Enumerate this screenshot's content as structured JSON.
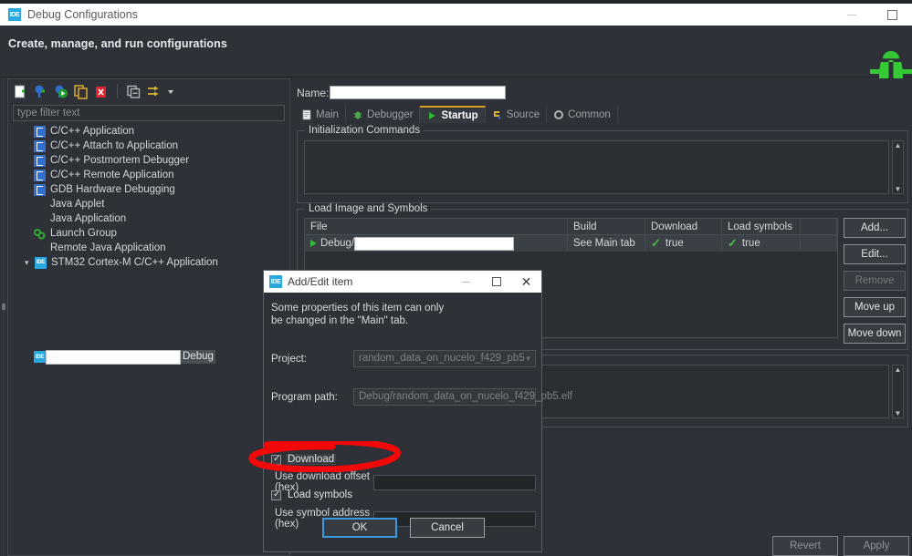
{
  "window": {
    "title": "Debug Configurations",
    "icon": "ide-icon",
    "minimize_label": "minimize-icon",
    "maximize_label": "maximize-icon"
  },
  "banner": {
    "heading": "Create, manage, and run configurations",
    "logo": "green-bug-icon"
  },
  "left_panel": {
    "toolbar_icons": [
      "new-configuration-icon",
      "new-prototype-icon",
      "export-icon",
      "duplicate-icon",
      "delete-icon",
      "collapse-all-icon",
      "filter-icon",
      "dropdown-arrow-icon"
    ],
    "filter_placeholder": "type filter text",
    "tree": [
      {
        "label": "C/C++ Application",
        "icon": "cpp-icon"
      },
      {
        "label": "C/C++ Attach to Application",
        "icon": "cpp-icon"
      },
      {
        "label": "C/C++ Postmortem Debugger",
        "icon": "cpp-icon"
      },
      {
        "label": "C/C++ Remote Application",
        "icon": "cpp-icon"
      },
      {
        "label": "GDB Hardware Debugging",
        "icon": "cpp-icon"
      },
      {
        "label": "Java Applet",
        "icon": "none"
      },
      {
        "label": "Java Application",
        "icon": "none"
      },
      {
        "label": "Launch Group",
        "icon": "launch-group-icon"
      },
      {
        "label": "Remote Java Application",
        "icon": "none"
      },
      {
        "label": "STM32 Cortex-M C/C++ Application",
        "icon": "ide-icon",
        "expanded": true
      }
    ],
    "inline_edit": {
      "value": "",
      "suffix_label": "Debug",
      "icon": "ide-icon"
    }
  },
  "right_panel": {
    "name_label": "Name:",
    "name_value": "",
    "tabs": [
      {
        "label": "Main",
        "icon": "document-icon",
        "active": false
      },
      {
        "label": "Debugger",
        "icon": "bug-icon",
        "active": false
      },
      {
        "label": "Startup",
        "icon": "play-icon",
        "active": true
      },
      {
        "label": "Source",
        "icon": "source-icon",
        "active": false
      },
      {
        "label": "Common",
        "icon": "gear-icon",
        "active": false
      }
    ],
    "init_commands": {
      "legend": "Initialization Commands",
      "value": ""
    },
    "load_image": {
      "legend": "Load Image and Symbols",
      "columns": [
        "File",
        "Build",
        "Download",
        "Load symbols",
        ""
      ],
      "rows": [
        {
          "file_prefix": "Debug/",
          "file_value": "",
          "build": "See Main tab",
          "download": "true",
          "load_symbols": "true"
        }
      ],
      "buttons": [
        {
          "label": "Add...",
          "disabled": false
        },
        {
          "label": "Edit...",
          "disabled": false
        },
        {
          "label": "Remove",
          "disabled": true
        },
        {
          "label": "Move up",
          "disabled": false
        },
        {
          "label": "Move down",
          "disabled": false
        }
      ]
    },
    "bottom_buttons": [
      {
        "label": "Revert"
      },
      {
        "label": "Apply"
      }
    ]
  },
  "dialog": {
    "title": "Add/Edit item",
    "icon": "ide-icon",
    "note_line1": "Some properties of this item can only",
    "note_line2": "be changed in the \"Main\" tab.",
    "project_label": "Project:",
    "project_value": "random_data_on_nucelo_f429_pb5",
    "program_path_label": "Program path:",
    "program_path_value": "Debug/random_data_on_nucelo_f429_pb5.elf",
    "download_checkbox": {
      "label": "Download",
      "checked": true
    },
    "download_offset_label": "Use download offset (hex)",
    "download_offset_value": "",
    "load_symbols_checkbox": {
      "label": "Load symbols",
      "checked": true
    },
    "symbol_address_label": "Use symbol address (hex)",
    "symbol_address_value": "",
    "ok_label": "OK",
    "cancel_label": "Cancel",
    "minimize_label": "minimize-icon",
    "maximize_label": "maximize-icon",
    "close_label": "close-icon"
  },
  "annotation": {
    "type": "red-ellipse-highlight",
    "target": "Use download offset (hex)",
    "color": "#f10808"
  },
  "colors": {
    "accent": "#29a8e0",
    "active_tab_underline": "#d8a12a",
    "check_green": "#3ec23e",
    "annotation_red": "#f10808"
  }
}
